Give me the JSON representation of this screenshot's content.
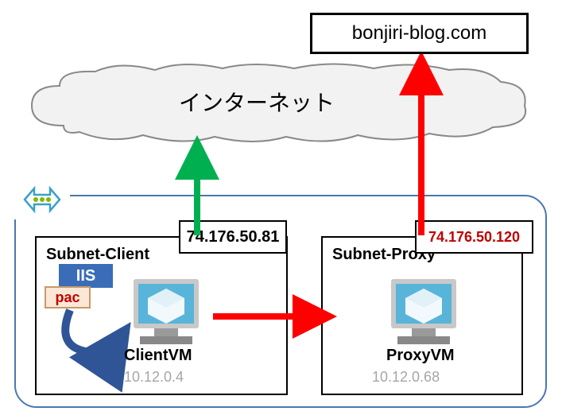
{
  "target_domain": "bonjiri-blog.com",
  "cloud_label": "インターネット",
  "vnet": {},
  "subnets": {
    "client": {
      "label": "Subnet-Client",
      "public_ip": "74.176.50.81",
      "vm_name": "ClientVM",
      "vm_ip": "10.12.0.4",
      "iis_label": "IIS",
      "pac_label": "pac"
    },
    "proxy": {
      "label": "Subnet-Proxy",
      "public_ip": "74.176.50.120",
      "vm_name": "ProxyVM",
      "vm_ip": "10.12.0.68"
    }
  },
  "arrows": {
    "green_client_to_internet": true,
    "red_client_to_proxy": true,
    "red_proxy_to_target": true,
    "curved_pac_to_client": true
  }
}
